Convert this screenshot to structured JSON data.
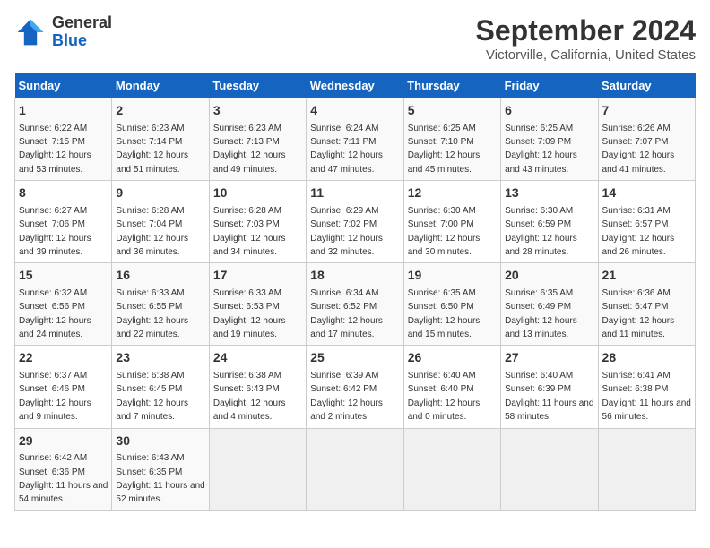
{
  "logo": {
    "line1": "General",
    "line2": "Blue"
  },
  "title": "September 2024",
  "subtitle": "Victorville, California, United States",
  "days_of_week": [
    "Sunday",
    "Monday",
    "Tuesday",
    "Wednesday",
    "Thursday",
    "Friday",
    "Saturday"
  ],
  "weeks": [
    [
      {
        "day": 1,
        "sunrise": "6:22 AM",
        "sunset": "7:15 PM",
        "daylight": "12 hours and 53 minutes."
      },
      {
        "day": 2,
        "sunrise": "6:23 AM",
        "sunset": "7:14 PM",
        "daylight": "12 hours and 51 minutes."
      },
      {
        "day": 3,
        "sunrise": "6:23 AM",
        "sunset": "7:13 PM",
        "daylight": "12 hours and 49 minutes."
      },
      {
        "day": 4,
        "sunrise": "6:24 AM",
        "sunset": "7:11 PM",
        "daylight": "12 hours and 47 minutes."
      },
      {
        "day": 5,
        "sunrise": "6:25 AM",
        "sunset": "7:10 PM",
        "daylight": "12 hours and 45 minutes."
      },
      {
        "day": 6,
        "sunrise": "6:25 AM",
        "sunset": "7:09 PM",
        "daylight": "12 hours and 43 minutes."
      },
      {
        "day": 7,
        "sunrise": "6:26 AM",
        "sunset": "7:07 PM",
        "daylight": "12 hours and 41 minutes."
      }
    ],
    [
      {
        "day": 8,
        "sunrise": "6:27 AM",
        "sunset": "7:06 PM",
        "daylight": "12 hours and 39 minutes."
      },
      {
        "day": 9,
        "sunrise": "6:28 AM",
        "sunset": "7:04 PM",
        "daylight": "12 hours and 36 minutes."
      },
      {
        "day": 10,
        "sunrise": "6:28 AM",
        "sunset": "7:03 PM",
        "daylight": "12 hours and 34 minutes."
      },
      {
        "day": 11,
        "sunrise": "6:29 AM",
        "sunset": "7:02 PM",
        "daylight": "12 hours and 32 minutes."
      },
      {
        "day": 12,
        "sunrise": "6:30 AM",
        "sunset": "7:00 PM",
        "daylight": "12 hours and 30 minutes."
      },
      {
        "day": 13,
        "sunrise": "6:30 AM",
        "sunset": "6:59 PM",
        "daylight": "12 hours and 28 minutes."
      },
      {
        "day": 14,
        "sunrise": "6:31 AM",
        "sunset": "6:57 PM",
        "daylight": "12 hours and 26 minutes."
      }
    ],
    [
      {
        "day": 15,
        "sunrise": "6:32 AM",
        "sunset": "6:56 PM",
        "daylight": "12 hours and 24 minutes."
      },
      {
        "day": 16,
        "sunrise": "6:33 AM",
        "sunset": "6:55 PM",
        "daylight": "12 hours and 22 minutes."
      },
      {
        "day": 17,
        "sunrise": "6:33 AM",
        "sunset": "6:53 PM",
        "daylight": "12 hours and 19 minutes."
      },
      {
        "day": 18,
        "sunrise": "6:34 AM",
        "sunset": "6:52 PM",
        "daylight": "12 hours and 17 minutes."
      },
      {
        "day": 19,
        "sunrise": "6:35 AM",
        "sunset": "6:50 PM",
        "daylight": "12 hours and 15 minutes."
      },
      {
        "day": 20,
        "sunrise": "6:35 AM",
        "sunset": "6:49 PM",
        "daylight": "12 hours and 13 minutes."
      },
      {
        "day": 21,
        "sunrise": "6:36 AM",
        "sunset": "6:47 PM",
        "daylight": "12 hours and 11 minutes."
      }
    ],
    [
      {
        "day": 22,
        "sunrise": "6:37 AM",
        "sunset": "6:46 PM",
        "daylight": "12 hours and 9 minutes."
      },
      {
        "day": 23,
        "sunrise": "6:38 AM",
        "sunset": "6:45 PM",
        "daylight": "12 hours and 7 minutes."
      },
      {
        "day": 24,
        "sunrise": "6:38 AM",
        "sunset": "6:43 PM",
        "daylight": "12 hours and 4 minutes."
      },
      {
        "day": 25,
        "sunrise": "6:39 AM",
        "sunset": "6:42 PM",
        "daylight": "12 hours and 2 minutes."
      },
      {
        "day": 26,
        "sunrise": "6:40 AM",
        "sunset": "6:40 PM",
        "daylight": "12 hours and 0 minutes."
      },
      {
        "day": 27,
        "sunrise": "6:40 AM",
        "sunset": "6:39 PM",
        "daylight": "11 hours and 58 minutes."
      },
      {
        "day": 28,
        "sunrise": "6:41 AM",
        "sunset": "6:38 PM",
        "daylight": "11 hours and 56 minutes."
      }
    ],
    [
      {
        "day": 29,
        "sunrise": "6:42 AM",
        "sunset": "6:36 PM",
        "daylight": "11 hours and 54 minutes."
      },
      {
        "day": 30,
        "sunrise": "6:43 AM",
        "sunset": "6:35 PM",
        "daylight": "11 hours and 52 minutes."
      },
      null,
      null,
      null,
      null,
      null
    ]
  ]
}
